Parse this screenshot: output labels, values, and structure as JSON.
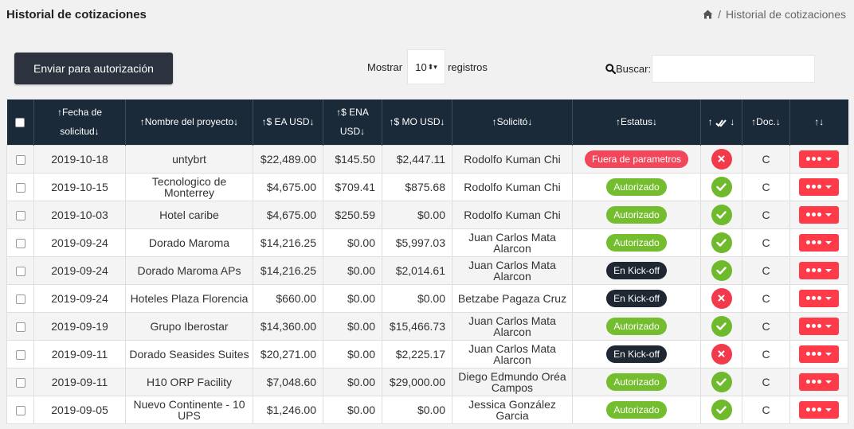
{
  "page": {
    "title": "Historial de cotizaciones",
    "breadcrumb": {
      "separator": "/",
      "current": "Historial de cotizaciones"
    }
  },
  "toolbar": {
    "auth_button": "Enviar para autorización",
    "show_label": "Mostrar",
    "show_value": "10",
    "records_label": "registros",
    "search_label": "Buscar:",
    "search_value": ""
  },
  "table": {
    "headers": {
      "date_l1": "↑Fecha de",
      "date_l2": "solicitud↓",
      "project": "↑Nombre del proyecto↓",
      "ea": "↑$ EA USD↓",
      "ena_l1": "↑$ ENA",
      "ena_l2": "USD↓",
      "mo": "↑$ MO USD↓",
      "requester": "↑Solicitó↓",
      "status": "↑Estatus↓",
      "approval_l": "↑",
      "approval_r": "↓",
      "doc": "↑Doc.↓",
      "actions": "↑↓"
    },
    "rows": [
      {
        "date": "2019-10-18",
        "project": "untybrt",
        "ea": "$22,489.00",
        "ena": "$145.50",
        "mo": "$2,447.11",
        "requester": "Rodolfo Kuman Chi",
        "status": "Fuera de parametros",
        "status_type": "red",
        "approved": false,
        "doc": "C"
      },
      {
        "date": "2019-10-15",
        "project": "Tecnologico de Monterrey",
        "ea": "$4,675.00",
        "ena": "$709.41",
        "mo": "$875.68",
        "requester": "Rodolfo Kuman Chi",
        "status": "Autorizado",
        "status_type": "green",
        "approved": true,
        "doc": "C"
      },
      {
        "date": "2019-10-03",
        "project": "Hotel caribe",
        "ea": "$4,675.00",
        "ena": "$250.59",
        "mo": "$0.00",
        "requester": "Rodolfo Kuman Chi",
        "status": "Autorizado",
        "status_type": "green",
        "approved": true,
        "doc": "C"
      },
      {
        "date": "2019-09-24",
        "project": "Dorado Maroma",
        "ea": "$14,216.25",
        "ena": "$0.00",
        "mo": "$5,997.03",
        "requester": "Juan Carlos Mata Alarcon",
        "status": "Autorizado",
        "status_type": "green",
        "approved": true,
        "doc": "C"
      },
      {
        "date": "2019-09-24",
        "project": "Dorado Maroma APs",
        "ea": "$14,216.25",
        "ena": "$0.00",
        "mo": "$2,014.61",
        "requester": "Juan Carlos Mata Alarcon",
        "status": "En Kick-off",
        "status_type": "dark",
        "approved": true,
        "doc": "C"
      },
      {
        "date": "2019-09-24",
        "project": "Hoteles Plaza Florencia",
        "ea": "$660.00",
        "ena": "$0.00",
        "mo": "$0.00",
        "requester": "Betzabe Pagaza Cruz",
        "status": "En Kick-off",
        "status_type": "dark",
        "approved": false,
        "doc": "C"
      },
      {
        "date": "2019-09-19",
        "project": "Grupo Iberostar",
        "ea": "$14,360.00",
        "ena": "$0.00",
        "mo": "$15,466.73",
        "requester": "Juan Carlos Mata Alarcon",
        "status": "Autorizado",
        "status_type": "green",
        "approved": true,
        "doc": "C"
      },
      {
        "date": "2019-09-11",
        "project": "Dorado Seasides Suites",
        "ea": "$20,271.00",
        "ena": "$0.00",
        "mo": "$2,225.17",
        "requester": "Juan Carlos Mata Alarcon",
        "status": "En Kick-off",
        "status_type": "dark",
        "approved": false,
        "doc": "C"
      },
      {
        "date": "2019-09-11",
        "project": "H10 ORP Facility",
        "ea": "$7,048.60",
        "ena": "$0.00",
        "mo": "$29,000.00",
        "requester": "Diego Edmundo Oréa Campos",
        "status": "Autorizado",
        "status_type": "green",
        "approved": true,
        "doc": "C"
      },
      {
        "date": "2019-09-05",
        "project": "Nuevo Continente - 10 UPS",
        "ea": "$1,246.00",
        "ena": "$0.00",
        "mo": "$0.00",
        "requester": "Jessica González Garcia",
        "status": "Autorizado",
        "status_type": "green",
        "approved": true,
        "doc": "C"
      }
    ]
  },
  "colors": {
    "header_bg": "#1b2a38",
    "button_dark": "#2c333e",
    "status_red": "#f2475a",
    "status_green": "#74bd2f",
    "status_dark": "#1f2733",
    "action_red": "#ff3b4a"
  },
  "icons": {
    "breadcrumb": "home-icon",
    "search": "search-icon",
    "approval_header": "double-check-icon",
    "approved": "check-icon",
    "rejected": "close-icon",
    "actions": "more-dots-icon"
  }
}
